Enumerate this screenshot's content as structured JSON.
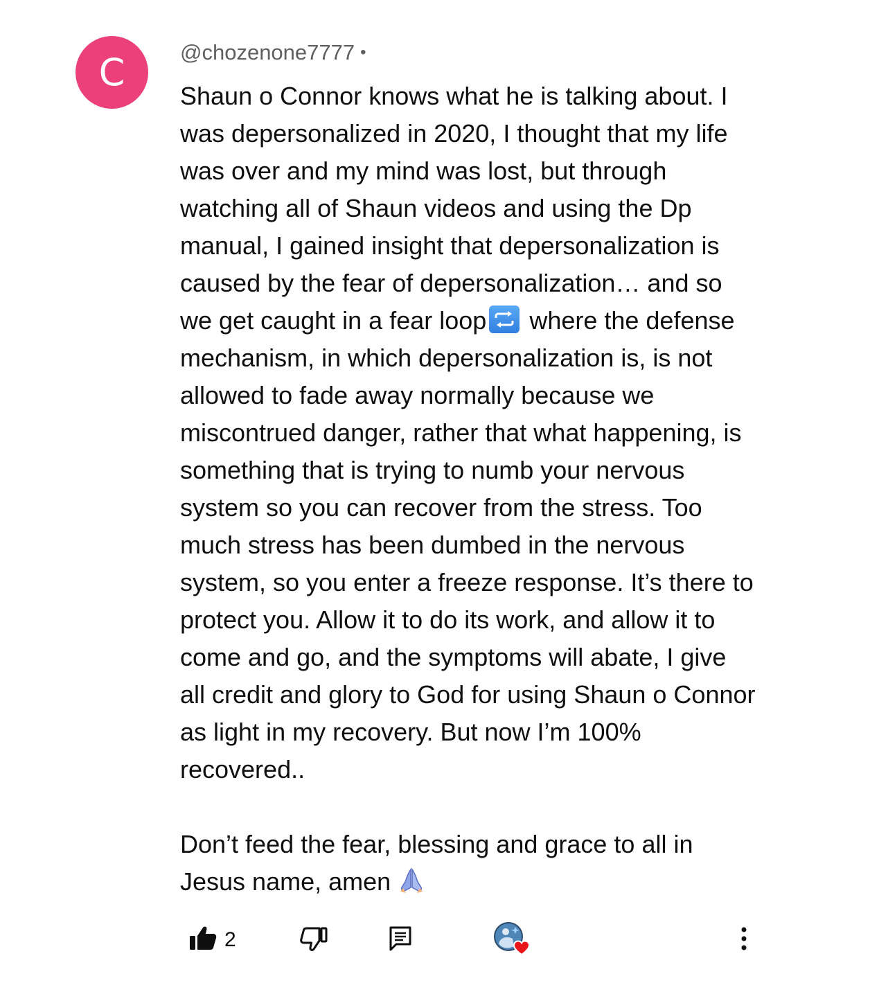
{
  "comment": {
    "avatar_letter": "C",
    "avatar_color": "#ec407a",
    "author": "@chozenone7777",
    "separator": "•",
    "text_part1": "Shaun o Connor knows what he is talking about. I\nwas depersonalized in 2020, I thought that my life\nwas over and my mind was lost, but through\nwatching all of Shaun videos and using the Dp\nmanual, I gained insight that depersonalization is\ncaused by the fear of depersonalization… and so\nwe get caught in a fear loop",
    "text_part2": " where the defense\nmechanism, in which depersonalization is, is not\nallowed to fade away normally because we\nmiscontrued danger,  rather that what happening, is\nsomething that is trying to numb your nervous\nsystem so you can recover from the stress. Too\nmuch stress has been dumbed in the nervous\nsystem, so you enter a freeze response. It’s there to\nprotect you. Allow it to do its work, and allow it to\ncome and go, and the symptoms will abate, I give\nall credit and glory to God for using Shaun o Connor\nas light in my recovery. But now I’m 100%\nrecovered..",
    "text_part3": "Don’t feed the fear, blessing and grace to all in\nJesus name, amen",
    "emoji_repeat": "repeat-button-emoji",
    "emoji_pray": "folded-hands-emoji"
  },
  "actions": {
    "like_icon": "thumbs-up-filled-icon",
    "like_count": "2",
    "dislike_icon": "thumbs-down-outline-icon",
    "reply_icon": "comment-reply-icon",
    "creator_heart_icon": "creator-heart-avatar-icon",
    "more_icon": "more-vertical-icon"
  }
}
